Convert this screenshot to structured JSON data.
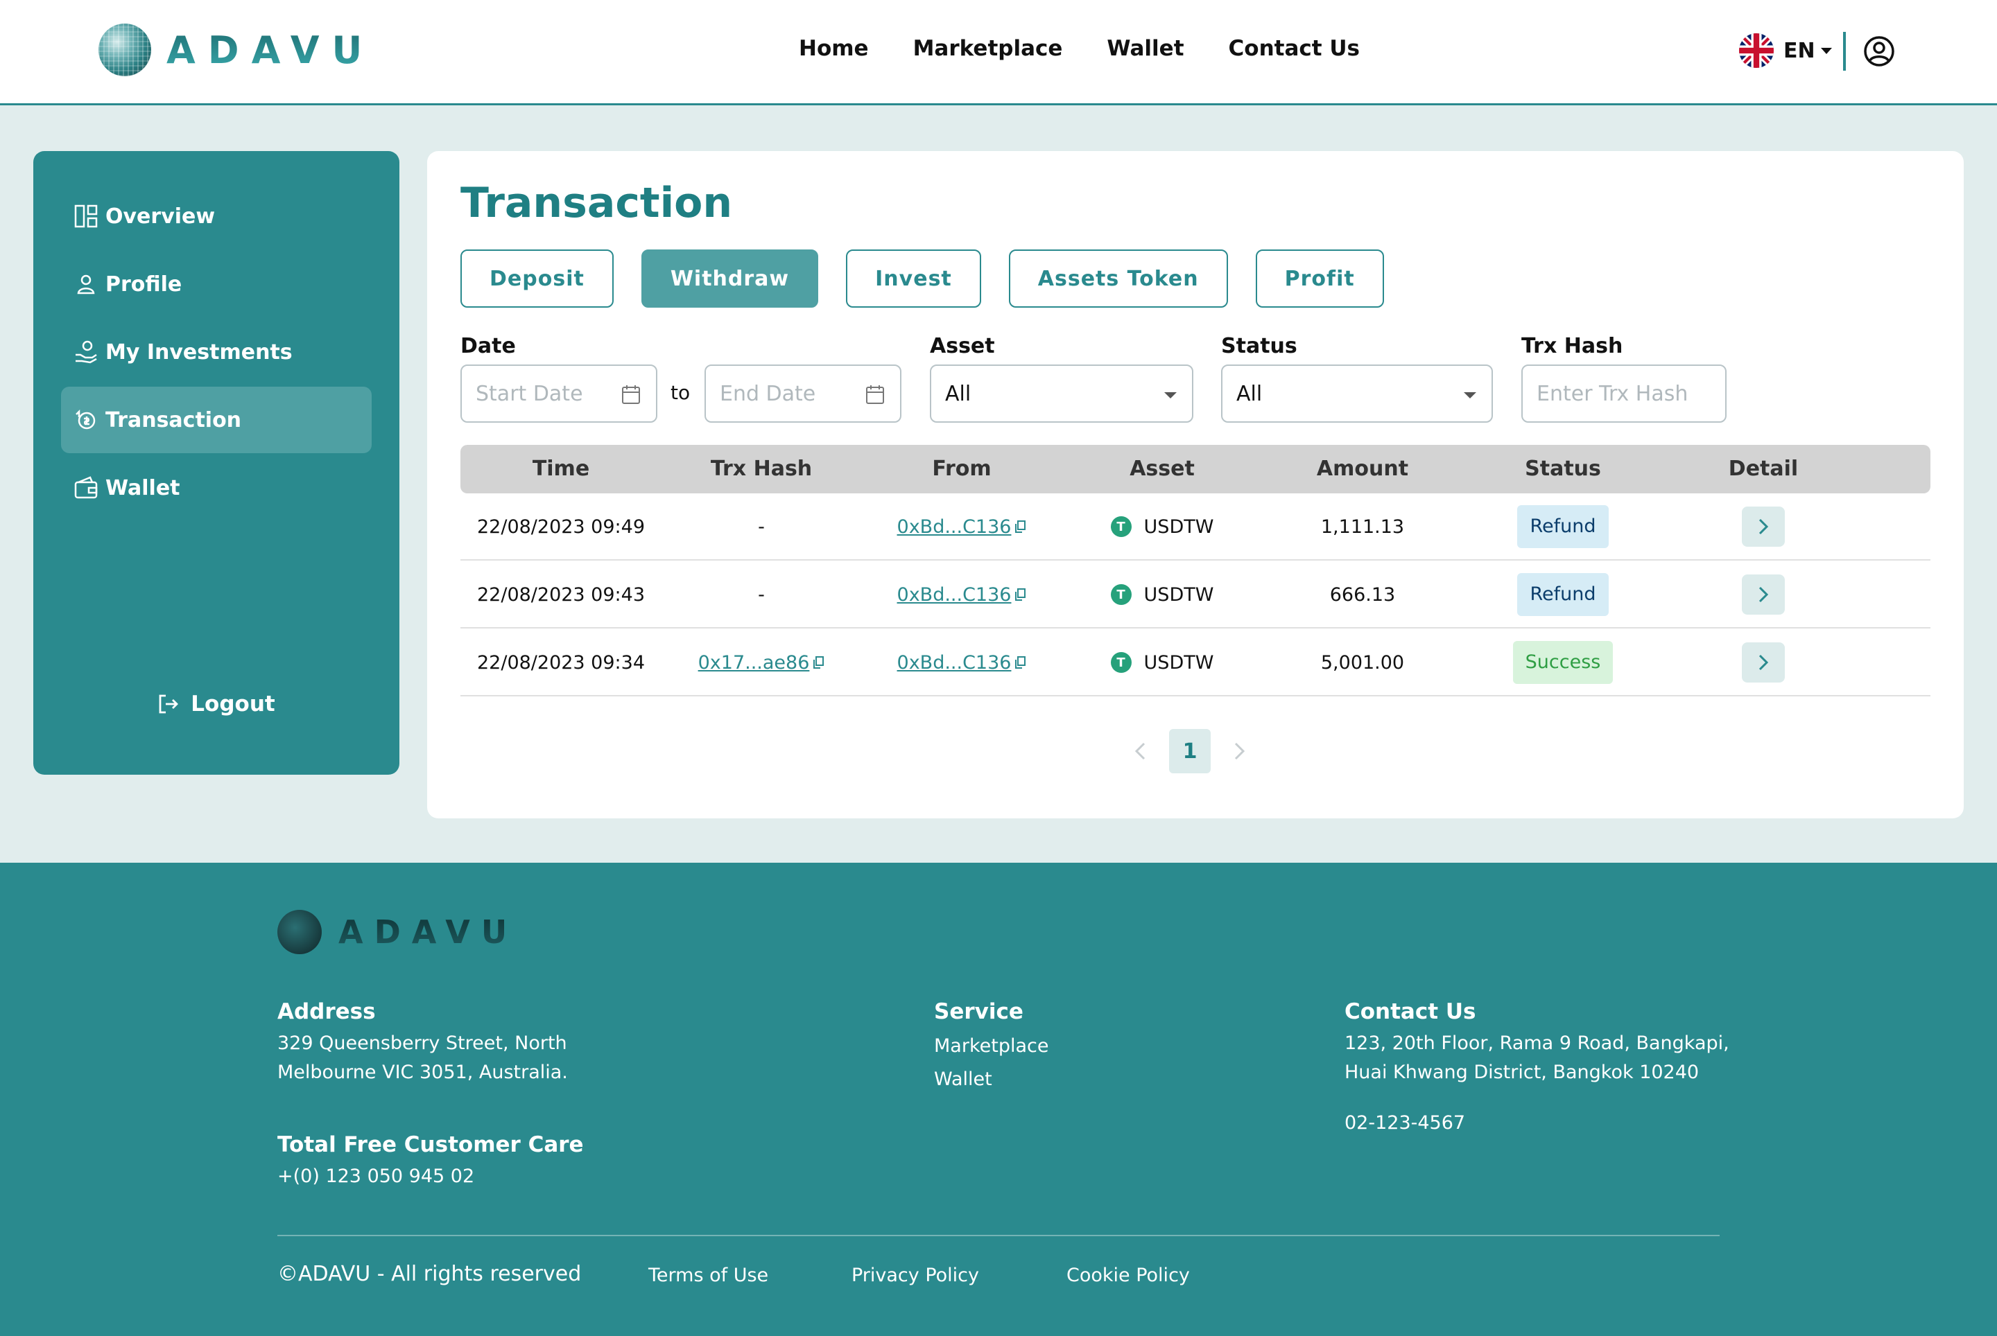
{
  "header": {
    "logo_text": "ADAVU",
    "nav": [
      "Home",
      "Marketplace",
      "Wallet",
      "Contact Us"
    ],
    "language": "EN"
  },
  "sidebar": {
    "items": [
      {
        "label": "Overview",
        "icon": "overview-icon"
      },
      {
        "label": "Profile",
        "icon": "profile-icon"
      },
      {
        "label": "My Investments",
        "icon": "investments-icon"
      },
      {
        "label": "Transaction",
        "icon": "transaction-icon",
        "active": true
      },
      {
        "label": "Wallet",
        "icon": "wallet-icon"
      }
    ],
    "logout": "Logout"
  },
  "main": {
    "title": "Transaction",
    "tabs": [
      {
        "label": "Deposit"
      },
      {
        "label": "Withdraw",
        "active": true
      },
      {
        "label": "Invest"
      },
      {
        "label": "Assets Token"
      },
      {
        "label": "Profit"
      }
    ],
    "filters": {
      "date_label": "Date",
      "start_placeholder": "Start Date",
      "to": "to",
      "end_placeholder": "End Date",
      "asset_label": "Asset",
      "asset_value": "All",
      "status_label": "Status",
      "status_value": "All",
      "hash_label": "Trx Hash",
      "hash_placeholder": "Enter Trx Hash"
    },
    "table": {
      "columns": [
        "Time",
        "Trx Hash",
        "From",
        "Asset",
        "Amount",
        "Status",
        "Detail"
      ],
      "rows": [
        {
          "time": "22/08/2023 09:49",
          "hash": "-",
          "from": "0xBd...C136",
          "asset": "USDTW",
          "amount": "1,111.13",
          "status": "Refund"
        },
        {
          "time": "22/08/2023 09:43",
          "hash": "-",
          "from": "0xBd...C136",
          "asset": "USDTW",
          "amount": "666.13",
          "status": "Refund"
        },
        {
          "time": "22/08/2023 09:34",
          "hash": "0x17...ae86",
          "from": "0xBd...C136",
          "asset": "USDTW",
          "amount": "5,001.00",
          "status": "Success"
        }
      ]
    },
    "pagination": {
      "current": "1"
    }
  },
  "footer": {
    "logo_text": "ADAVU",
    "address_title": "Address",
    "address_line1": "329 Queensberry Street, North",
    "address_line2": "Melbourne VIC 3051, Australia.",
    "care_title": "Total Free Customer Care",
    "care_phone": "+(0) 123 050 945 02",
    "service_title": "Service",
    "service_links": [
      "Marketplace",
      "Wallet"
    ],
    "contact_title": "Contact Us",
    "contact_line1": "123, 20th Floor, Rama 9 Road, Bangkapi,",
    "contact_line2": "Huai Khwang District, Bangkok 10240",
    "contact_phone": "02-123-4567",
    "copyright": "©ADAVU - All rights reserved",
    "legal_links": [
      "Terms of Use",
      "Privacy Policy",
      "Cookie Policy"
    ]
  },
  "colors": {
    "brand": "#2a8a8e",
    "active_tab": "#4fa0a3",
    "page_bg": "#e1eded",
    "refund_bg": "#d6ecf6",
    "success_bg": "#d8f3dc"
  }
}
